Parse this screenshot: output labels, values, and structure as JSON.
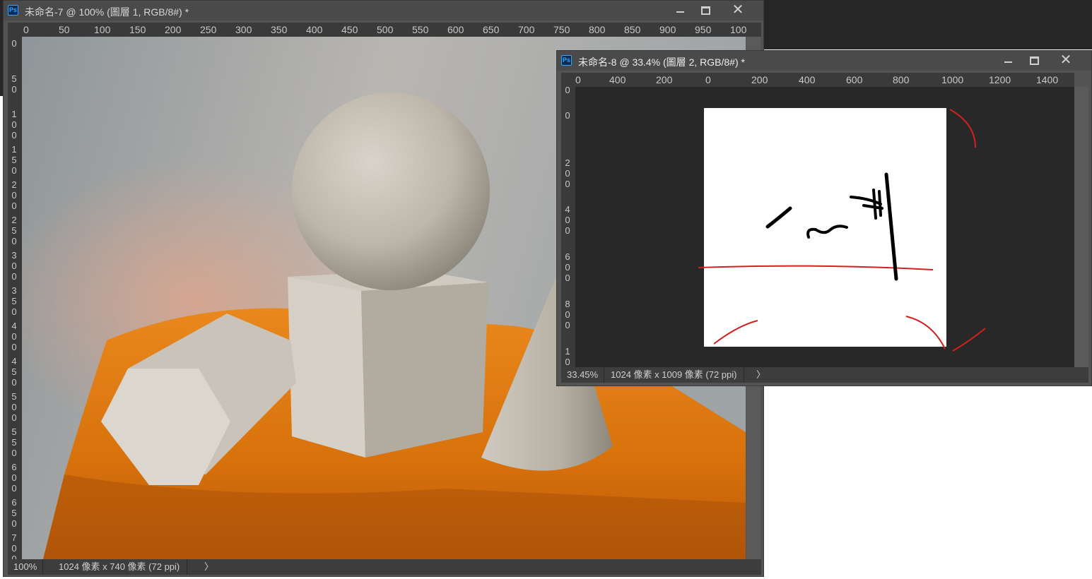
{
  "window1": {
    "title": "未命名-7 @ 100% (圖層 1, RGB/8#) *",
    "ps_label": "Ps",
    "ruler_h": [
      "0",
      "50",
      "100",
      "150",
      "200",
      "250",
      "300",
      "350",
      "400",
      "450",
      "500",
      "550",
      "600",
      "650",
      "700",
      "750",
      "800",
      "850",
      "900",
      "950",
      "100"
    ],
    "ruler_v": [
      "0",
      "5 0",
      "1 0 0",
      "1 5 0",
      "2 0 0",
      "2 5 0",
      "3 0 0",
      "3 5 0",
      "4 0 0",
      "4 5 0",
      "5 0 0",
      "5 5 0",
      "6 0 0",
      "6 5 0",
      "7 0 0"
    ],
    "zoom": "100%",
    "doc_info": "1024 像素 x 740 像素 (72 ppi)",
    "arrow": "〉",
    "close_glyph": "✕"
  },
  "window2": {
    "title": "未命名-8 @ 33.4% (圖層 2, RGB/8#) *",
    "ps_label": "Ps",
    "ruler_h": [
      "0",
      "400",
      "200",
      "0",
      "200",
      "400",
      "600",
      "800",
      "1000",
      "1200",
      "1400"
    ],
    "ruler_v": [
      "0",
      "0",
      "2 0 0",
      "4 0 0",
      "6 0 0",
      "8 0 0",
      "1 0"
    ],
    "zoom": "33.45%",
    "doc_info": "1024 像素 x 1009 像素 (72 ppi)",
    "arrow": "〉",
    "close_glyph": "✕"
  },
  "colors": {
    "panel": "#535353",
    "canvas_bg": "#282828",
    "cloth": "#e07a10",
    "stroke_red": "#d42020",
    "stroke_black": "#000000"
  },
  "icons": [
    "photoshop-icon",
    "minimize-icon",
    "maximize-icon",
    "close-icon",
    "chevron-right-icon"
  ]
}
